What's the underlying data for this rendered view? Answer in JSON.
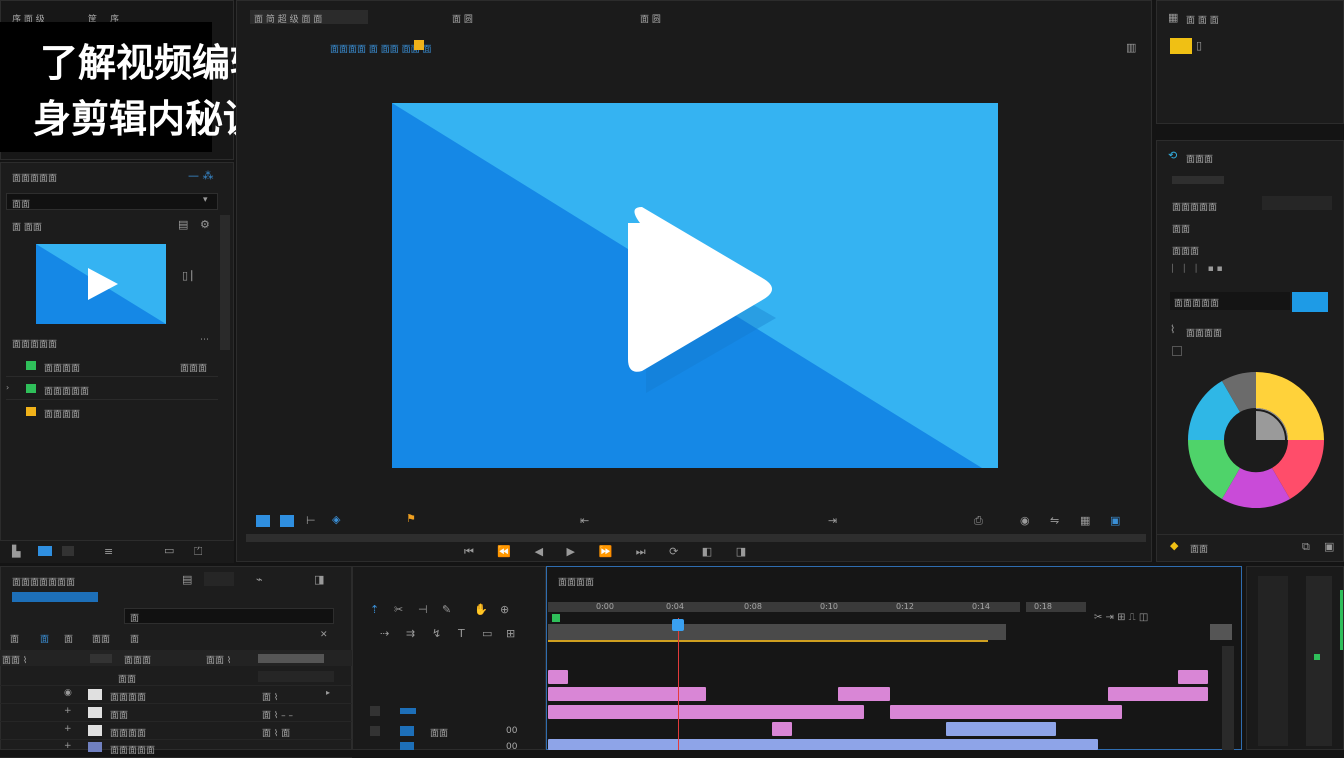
{
  "overlay": {
    "line1": "了解视频编辑要、",
    "line2": "身剪辑内秘诀"
  },
  "topbar": {
    "left_items": [
      "序 面 级",
      "筐",
      "序"
    ],
    "left_badge": "圆",
    "center_tabs": [
      "面 简 超 级 面 面",
      "面 圆",
      "面 圆"
    ],
    "info_line": "面面面面 面 面面 面面 面"
  },
  "left_panel": {
    "header": "面面面面面",
    "dropdown_value": "面面",
    "bin_label": "面  面面",
    "sub_header": "面面面面面",
    "items": [
      {
        "label": "面面面面",
        "meta": "面面面",
        "color": "#2fbf5a"
      },
      {
        "label": "面面面面面",
        "meta": "",
        "color": "#2fbf5a"
      },
      {
        "label": "面面面面",
        "meta": "",
        "color": "#f0b21a"
      }
    ]
  },
  "right_panel": {
    "top_title": "面 面 面",
    "effects_title": "面面面",
    "rows": [
      "面面面面面",
      "面面",
      "面面面",
      "面面面面面"
    ],
    "color_section": "面面面面",
    "accent": "#1e9be6",
    "bottom_label": "面面"
  },
  "timeline": {
    "left_title": "面面面面面面面",
    "tabs": [
      "面",
      "面",
      "面",
      "面面",
      "面"
    ],
    "search_placeholder": "面",
    "track_labels": [
      "面面面面",
      "面面",
      "面面面面",
      "面面面面面"
    ],
    "right_title": "面面面面",
    "ruler_marks": [
      "0:00",
      "0:04",
      "0:08",
      "0:10",
      "0:12",
      "0:14",
      "0:18"
    ]
  },
  "colors": {
    "preview_light": "#35b3f2",
    "preview_dark": "#1588e6",
    "clip_pink": "#d986d6",
    "clip_blue": "#8ea4e8",
    "playhead": "#e23b3b"
  }
}
